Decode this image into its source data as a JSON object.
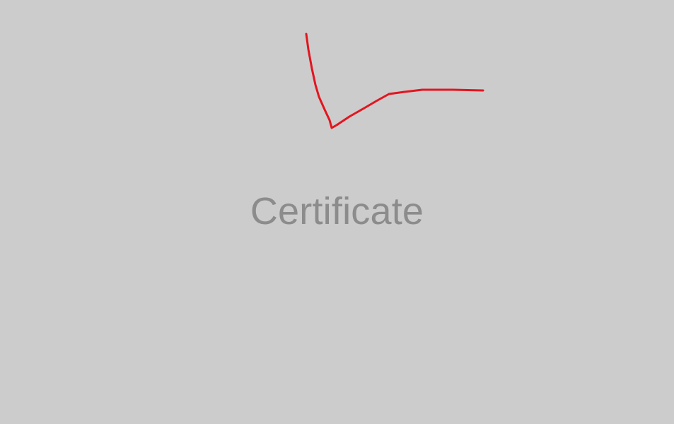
{
  "title": "Certificate",
  "colors": {
    "background": "#cccccc",
    "title_text": "#8c8c8c",
    "annotation_stroke": "#e3151f"
  }
}
